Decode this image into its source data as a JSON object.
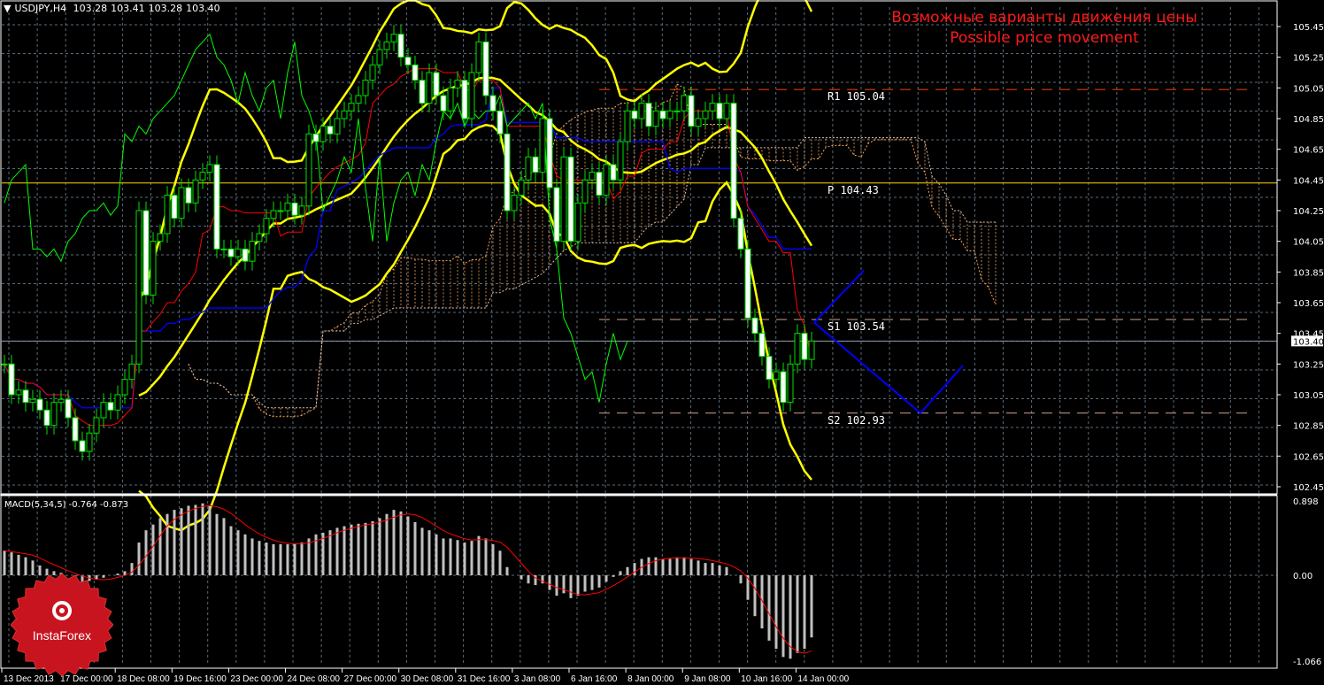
{
  "header": {
    "symbol": "USDJPY,H4",
    "open": "103.28",
    "high": "103.41",
    "low": "103.28",
    "close": "103.40"
  },
  "annotation": {
    "line1": "Возможные варианты движения цены",
    "line2": "Possible price movement"
  },
  "macd": {
    "label": "MACD(5,34,5)",
    "main": "-0.764",
    "signal": "-0.873"
  },
  "logo": {
    "text": "InstaForex"
  },
  "colors": {
    "bollinger": "#ffff00",
    "tenkan": "#ff0000",
    "kijun": "#0000ff",
    "chikou": "#00ff00",
    "cloud": "#f4a460",
    "forecast": "#0000ff",
    "title": "#ff1a1a"
  },
  "chart_data": {
    "type": "candlestick",
    "title": "USDJPY,H4",
    "ylim": [
      102.38,
      105.62
    ],
    "yticks": [
      "105.45",
      "105.25",
      "105.05",
      "104.85",
      "104.65",
      "104.45",
      "104.25",
      "104.05",
      "103.85",
      "103.65",
      "103.45",
      "103.25",
      "103.05",
      "102.85",
      "102.65",
      "102.45"
    ],
    "current_price": "103.40",
    "xticks": [
      "13 Dec 2013",
      "17 Dec 00:00",
      "18 Dec 08:00",
      "19 Dec 16:00",
      "23 Dec 00:00",
      "24 Dec 08:00",
      "27 Dec 00:00",
      "30 Dec 08:00",
      "31 Dec 16:00",
      "3 Jan 08:00",
      "6 Jan 16:00",
      "8 Jan 00:00",
      "9 Jan 08:00",
      "10 Jan 16:00",
      "14 Jan 00:00"
    ],
    "closes": [
      103.25,
      103.05,
      103.08,
      103.0,
      103.02,
      102.95,
      102.85,
      103.0,
      103.02,
      102.9,
      102.75,
      102.68,
      102.8,
      102.9,
      103.0,
      102.95,
      103.05,
      103.15,
      103.25,
      104.25,
      103.7,
      104.05,
      104.1,
      104.35,
      104.2,
      104.4,
      104.3,
      104.45,
      104.5,
      104.55,
      104.0,
      104.0,
      103.95,
      104.0,
      103.92,
      104.05,
      104.1,
      104.2,
      104.25,
      104.25,
      104.3,
      104.22,
      104.28,
      104.75,
      104.7,
      104.8,
      104.75,
      104.85,
      104.9,
      104.95,
      105.0,
      105.1,
      105.2,
      105.3,
      105.35,
      105.4,
      105.25,
      105.2,
      105.1,
      104.95,
      105.15,
      105.0,
      104.9,
      105.05,
      105.1,
      104.85,
      105.15,
      105.35,
      105.0,
      104.9,
      104.75,
      104.25,
      104.35,
      104.45,
      104.6,
      104.5,
      104.85,
      104.4,
      104.05,
      104.6,
      104.05,
      104.3,
      104.45,
      104.5,
      104.35,
      104.55,
      104.45,
      104.7,
      104.9,
      104.85,
      104.95,
      104.8,
      104.9,
      104.85,
      104.9,
      104.9,
      105.0,
      104.8,
      104.85,
      104.9,
      104.95,
      104.85,
      104.95,
      104.2,
      104.0,
      103.55,
      103.45,
      103.3,
      103.15,
      103.2,
      103.0,
      103.25,
      103.45,
      103.28,
      103.4
    ],
    "pivots": [
      {
        "name": "R1",
        "value": "105.04",
        "color": "#ff4500"
      },
      {
        "name": "P",
        "value": "104.43",
        "color": "#ffd700"
      },
      {
        "name": "S1",
        "value": "103.54",
        "color": "#d2a090"
      },
      {
        "name": "S2",
        "value": "102.93",
        "color": "#d2a090"
      }
    ],
    "forecast_paths": [
      [
        [
          0,
          103.52
        ],
        [
          7,
          103.86
        ]
      ],
      [
        [
          0,
          103.52
        ],
        [
          15,
          102.93
        ],
        [
          21,
          103.24
        ]
      ]
    ],
    "macd": {
      "ylim": [
        -1.066,
        0.898
      ],
      "ticks": [
        "0.898",
        "0.00",
        "-1.066"
      ],
      "values": [
        0.3,
        0.28,
        0.25,
        0.22,
        0.18,
        0.12,
        0.08,
        0.05,
        0.03,
        0.0,
        -0.05,
        -0.08,
        -0.07,
        -0.05,
        -0.03,
        0.0,
        0.02,
        0.05,
        0.15,
        0.4,
        0.55,
        0.62,
        0.7,
        0.75,
        0.8,
        0.82,
        0.85,
        0.86,
        0.88,
        0.85,
        0.75,
        0.7,
        0.6,
        0.55,
        0.5,
        0.45,
        0.42,
        0.4,
        0.38,
        0.38,
        0.38,
        0.38,
        0.4,
        0.45,
        0.5,
        0.52,
        0.55,
        0.58,
        0.6,
        0.62,
        0.63,
        0.64,
        0.66,
        0.7,
        0.75,
        0.8,
        0.78,
        0.72,
        0.65,
        0.58,
        0.55,
        0.5,
        0.45,
        0.45,
        0.43,
        0.4,
        0.42,
        0.48,
        0.45,
        0.38,
        0.3,
        0.1,
        0.0,
        -0.05,
        -0.1,
        -0.12,
        -0.1,
        -0.18,
        -0.25,
        -0.22,
        -0.28,
        -0.25,
        -0.2,
        -0.18,
        -0.15,
        -0.08,
        -0.02,
        0.05,
        0.1,
        0.15,
        0.2,
        0.22,
        0.22,
        0.2,
        0.2,
        0.22,
        0.22,
        0.2,
        0.18,
        0.15,
        0.15,
        0.12,
        0.1,
        0.0,
        -0.1,
        -0.3,
        -0.5,
        -0.65,
        -0.8,
        -0.9,
        -1.0,
        -1.02,
        -0.95,
        -0.9,
        -0.76
      ]
    }
  }
}
